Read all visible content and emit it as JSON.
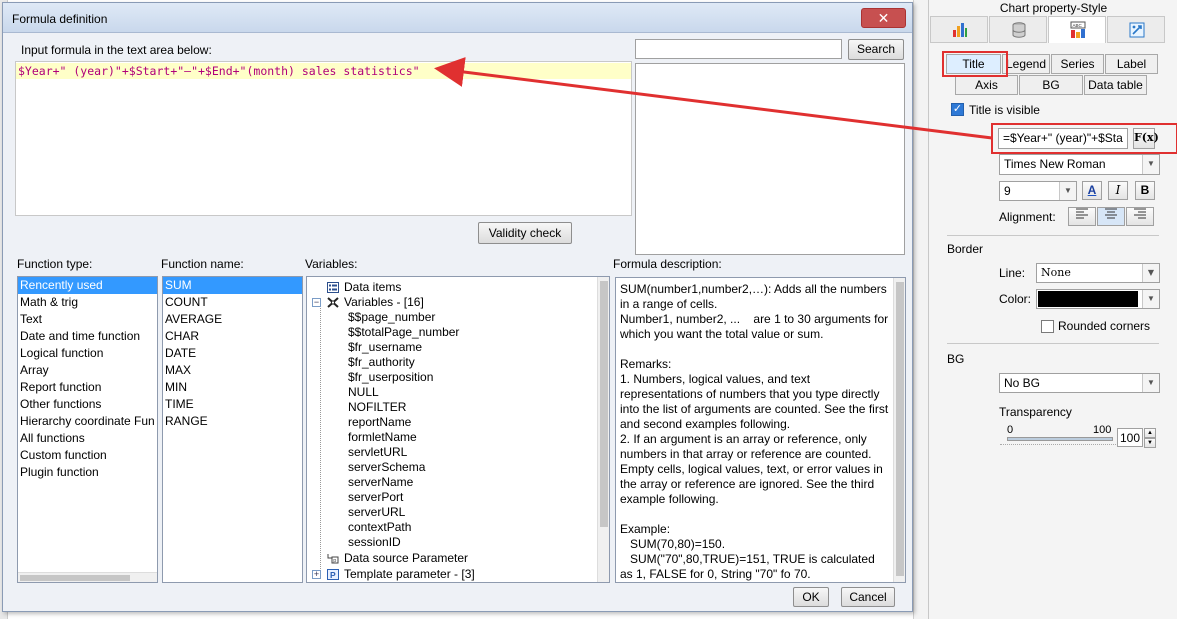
{
  "dialog": {
    "title": "Formula definition",
    "close_icon": "close-icon",
    "input_prompt": "Input formula in the text area below:",
    "formula": "$Year+\" (year)\"+$Start+\"—\"+$End+\"(month) sales statistics\"",
    "search_label": "Search",
    "search_value": "",
    "validity_label": "Validity check",
    "function_type_label": "Function type:",
    "function_name_label": "Function name:",
    "variables_label": "Variables:",
    "description_label": "Formula description:",
    "function_types": [
      "Rencently used",
      "Math & trig",
      "Text",
      "Date and time function",
      "Logical function",
      "Array",
      "Report function",
      "Other functions",
      "Hierarchy coordinate Fun",
      "All functions",
      "Custom function",
      "Plugin function"
    ],
    "selected_type": "Rencently used",
    "function_names": [
      "SUM",
      "COUNT",
      "AVERAGE",
      "CHAR",
      "DATE",
      "MAX",
      "MIN",
      "TIME",
      "RANGE"
    ],
    "selected_name": "SUM",
    "variables_tree": {
      "data_items": "Data items",
      "variables_group": "Variables - [16]",
      "variables": [
        "$$page_number",
        "$$totalPage_number",
        "$fr_username",
        "$fr_authority",
        "$fr_userposition",
        "NULL",
        "NOFILTER",
        "reportName",
        "formletName",
        "servletURL",
        "serverSchema",
        "serverName",
        "serverPort",
        "serverURL",
        "contextPath",
        "sessionID"
      ],
      "datasource_param": "Data source Parameter",
      "template_param": "Template parameter - [3]"
    },
    "description": "SUM(number1,number2,…): Adds all the numbers in a range of cells.\nNumber1, number2, ...    are 1 to 30 arguments for which you want the total value or sum.\n\nRemarks:\n1. Numbers, logical values, and text representations of numbers that you type directly into the list of arguments are counted. See the first and second examples following.\n2. If an argument is an array or reference, only numbers in that array or reference are counted. Empty cells, logical values, text, or error values in the array or reference are ignored. See the third example following.\n\nExample:\n   SUM(70,80)=150.\n   SUM(\"70\",80,TRUE)=151, TRUE is calculated as 1, FALSE for 0, String \"70\" fo 70.",
    "ok_label": "OK",
    "cancel_label": "Cancel"
  },
  "panel": {
    "title": "Chart property-Style",
    "icon_tabs": [
      "chart-type-icon",
      "database-icon",
      "style-icon",
      "effects-icon"
    ],
    "tabs_row1": [
      "Title",
      "Legend",
      "Series",
      "Label"
    ],
    "tabs_row2": [
      "Axis",
      "BG",
      "Data table"
    ],
    "active_tab": "Title",
    "title_visible_label": "Title is visible",
    "title_visible": true,
    "title_formula": "=$Year+\" (year)\"+$Sta",
    "fx_label": "F(x)",
    "font_family": "Times New Roman",
    "font_size": "9",
    "bold_label": "B",
    "italic_label": "I",
    "font_color_label": "A",
    "alignment_label": "Alignment:",
    "border_label": "Border",
    "line_label": "Line:",
    "line_value": "None",
    "color_label": "Color:",
    "color_value": "#000000",
    "rounded_label": "Rounded corners",
    "rounded": false,
    "bg_label": "BG",
    "bg_value": "No BG",
    "transparency_label": "Transparency",
    "slider_min": "0",
    "slider_max": "100",
    "transparency_value": "100",
    "transparency_level": 1.0
  },
  "colors": {
    "accent_selection": "#3399ff",
    "annotation_red": "#e03030",
    "formula_text": "#b0007a",
    "formula_highlight": "#ffffc8"
  }
}
